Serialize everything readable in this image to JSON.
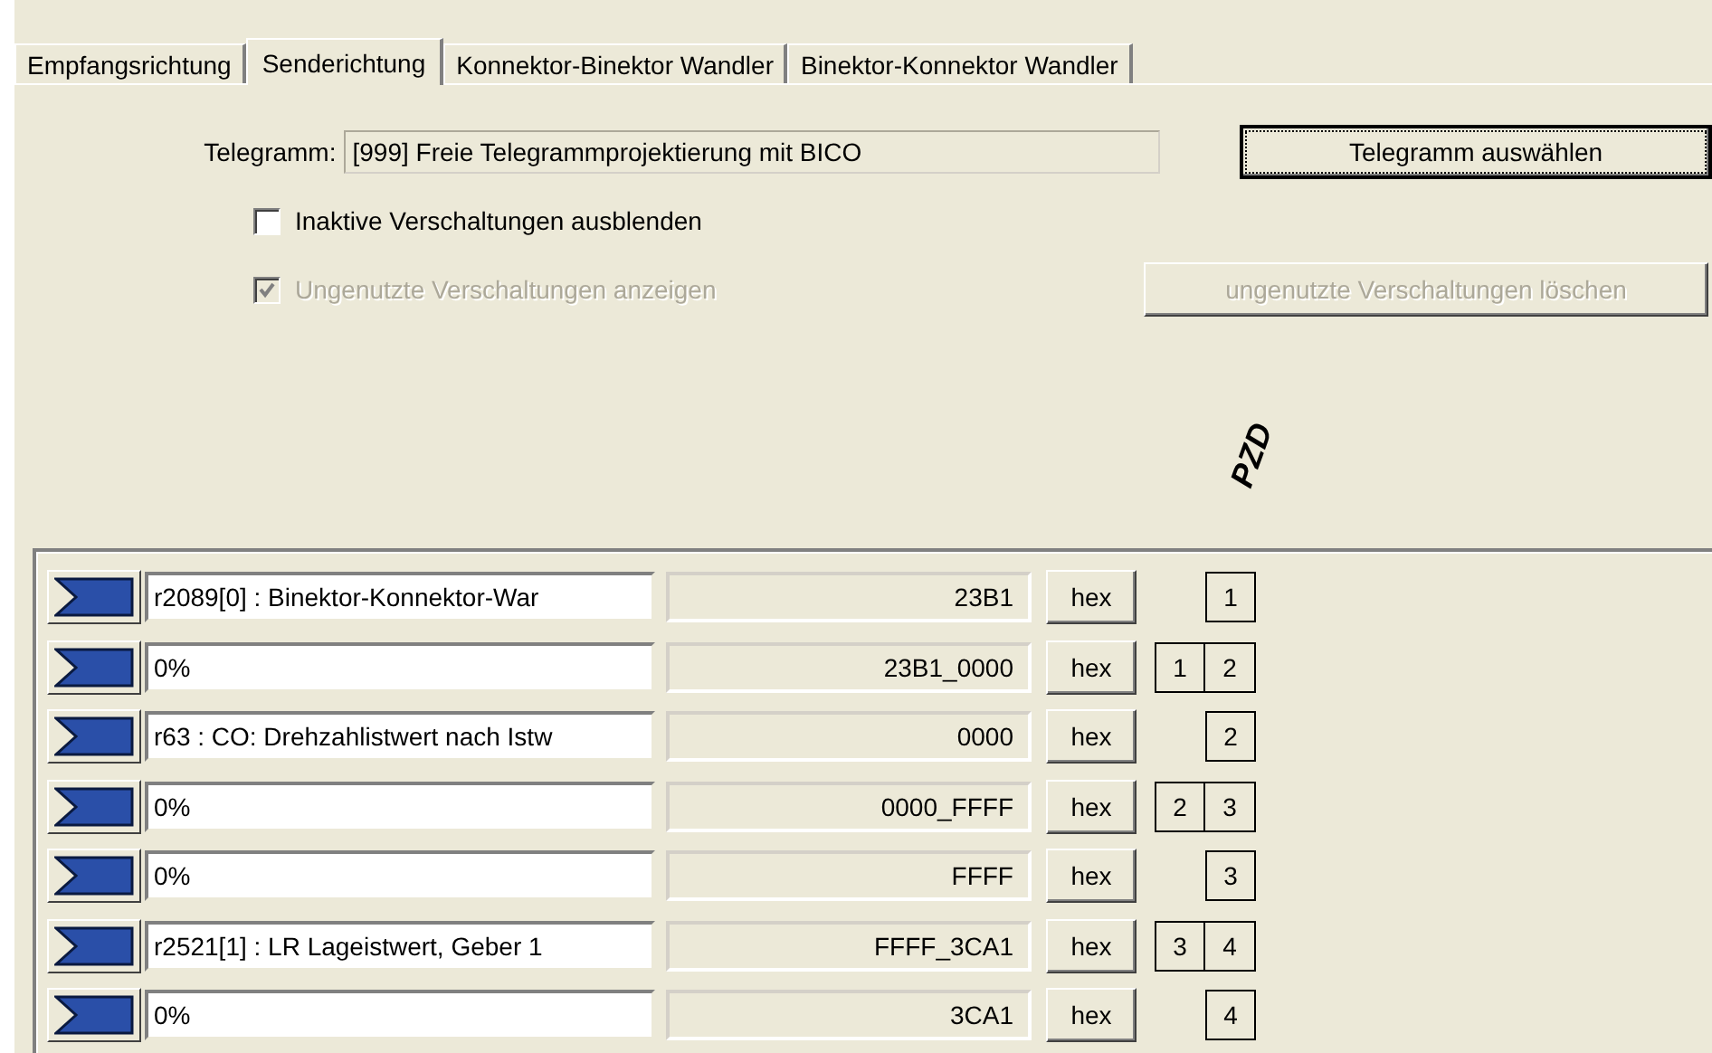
{
  "tabs": [
    {
      "label": "Empfangsrichtung",
      "selected": false
    },
    {
      "label": "Senderichtung",
      "selected": true
    },
    {
      "label": "Konnektor-Binektor Wandler",
      "selected": false
    },
    {
      "label": "Binektor-Konnektor Wandler",
      "selected": false
    }
  ],
  "telegram": {
    "label": "Telegramm:",
    "value": "[999] Freie Telegrammprojektierung mit BICO"
  },
  "select_button": {
    "label": "Telegramm auswählen",
    "focused": true
  },
  "checkboxes": [
    {
      "label": "Inaktive Verschaltungen ausblenden",
      "checked": false,
      "disabled": false
    },
    {
      "label": "Ungenutzte Verschaltungen anzeigen",
      "checked": true,
      "disabled": true
    }
  ],
  "delete_button": {
    "label": "ungenutzte Verschaltungen löschen",
    "disabled": true
  },
  "pzd_header": "PZD",
  "rows": [
    {
      "source": "r2089[0] : Binektor-Konnektor-War",
      "value": "23B1",
      "format": "hex",
      "pzd": [
        "1"
      ]
    },
    {
      "source": "0%",
      "value": "23B1_0000",
      "format": "hex",
      "pzd": [
        "1",
        "2"
      ]
    },
    {
      "source": "r63 : CO: Drehzahlistwert nach Istw",
      "value": "0000",
      "format": "hex",
      "pzd": [
        "2"
      ]
    },
    {
      "source": "0%",
      "value": "0000_FFFF",
      "format": "hex",
      "pzd": [
        "2",
        "3"
      ]
    },
    {
      "source": "0%",
      "value": "FFFF",
      "format": "hex",
      "pzd": [
        "3"
      ]
    },
    {
      "source": "r2521[1] : LR Lageistwert, Geber 1",
      "value": "FFFF_3CA1",
      "format": "hex",
      "pzd": [
        "3",
        "4"
      ]
    },
    {
      "source": "0%",
      "value": "3CA1",
      "format": "hex",
      "pzd": [
        "4"
      ]
    }
  ]
}
